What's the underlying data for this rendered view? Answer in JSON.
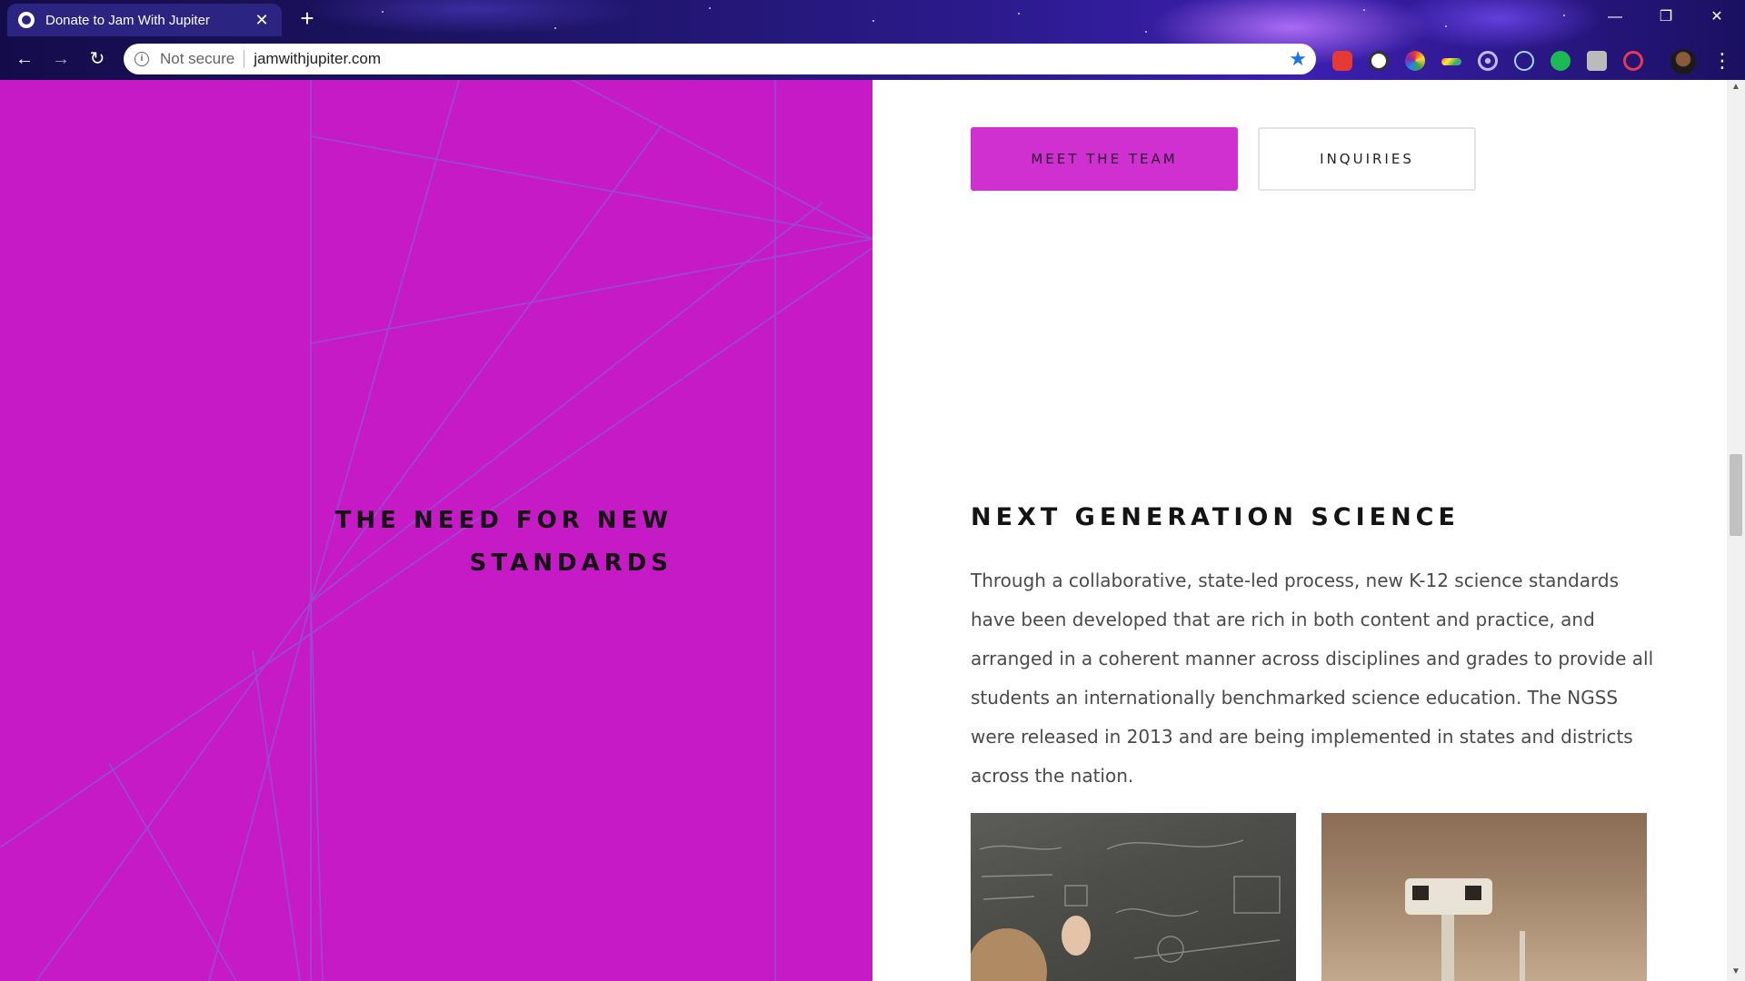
{
  "browser": {
    "tab_title": "Donate to Jam With Jupiter",
    "tab_close": "✕",
    "new_tab": "+",
    "security_label": "Not secure",
    "url": "jamwithjupiter.com",
    "window_minimize": "—",
    "window_restore": "❐",
    "window_close": "✕",
    "nav_back": "←",
    "nav_forward": "→",
    "nav_reload": "↻",
    "bookmark_star": "★",
    "menu": "⋮",
    "extension_icons": [
      "adblock-icon",
      "extension-circle-icon",
      "color-picker-icon",
      "rainbow-icon",
      "target-icon",
      "react-devtools-icon",
      "green-dot-icon",
      "puzzle-icon",
      "lastpass-icon"
    ]
  },
  "left_panel": {
    "background": "#c61ac6",
    "heading_line1": "THE NEED FOR NEW",
    "heading_line2": "STANDARDS"
  },
  "right_panel": {
    "meet_team_label": "MEET THE TEAM",
    "inquiries_label": "INQUIRIES",
    "accent_color": "#cf30cf",
    "heading": "NEXT GENERATION SCIENCE",
    "body": "Through a collaborative, state-led process, new K-12 science standards have been developed that are rich in both content and practice, and arranged in a coherent manner across disciplines and grades to provide all students an internationally benchmarked science education. The NGSS were released in 2013 and are being implemented in states and districts across the nation.",
    "photos": [
      "chalkboard-photo",
      "mars-rover-photo"
    ]
  }
}
